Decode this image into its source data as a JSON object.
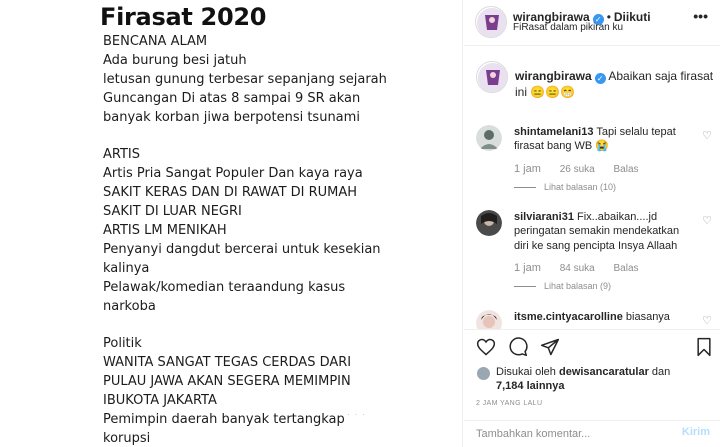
{
  "post": {
    "title": "Firasat 2020",
    "lines": [
      "BENCANA ALAM",
      "Ada burung besi jatuh",
      "letusan gunung terbesar sepanjang sejarah",
      "Guncangan Di atas 8 sampai 9 SR akan",
      "banyak korban jiwa berpotensi tsunami",
      "",
      "ARTIS",
      "Artis Pria Sangat Populer Dan kaya raya",
      "SAKIT KERAS DAN DI RAWAT DI RUMAH",
      "SAKIT DI LUAR NEGRI",
      "ARTIS LM MENIKAH",
      "Penyanyi dangdut bercerai untuk kesekian",
      "kalinya",
      "Pelawak/komedian teraandung kasus",
      "narkoba",
      "",
      "Politik",
      "WANITA SANGAT TEGAS CERDAS DARI",
      "PULAU JAWA AKAN SEGERA MEMIMPIN",
      "IBUKOTA JAKARTA",
      "Pemimpin daerah banyak tertangkap",
      "korupsi"
    ]
  },
  "header": {
    "username": "wirangbirawa",
    "separator": "•",
    "follow_status": "Diikuti",
    "location": "FiRasat dalam pikiran ku"
  },
  "caption": {
    "username": "wirangbirawa",
    "text": "Abaikan saja firasat ini 😑😑😁"
  },
  "comments": [
    {
      "username": "shintamelani13",
      "text": "Tapi selalu tepat firasat bang WB 😭",
      "time": "1 jam",
      "likes": "26 suka",
      "reply": "Balas",
      "view_replies": "Lihat balasan (10)"
    },
    {
      "username": "silviarani31",
      "text": "Fix..abaikan....jd peringatan semakin mendekatkan diri ke sang pencipta Insya Allaah",
      "time": "1 jam",
      "likes": "84 suka",
      "reply": "Balas",
      "view_replies": "Lihat balasan (9)"
    },
    {
      "username": "itsme.cintyacarolline",
      "text": "biasanya"
    }
  ],
  "likes": {
    "prefix": "Disukai oleh",
    "user": "dewisancaratular",
    "middle": "dan",
    "count": "7,184 lainnya"
  },
  "posted_time": "2 JAM YANG LALU",
  "add_comment": {
    "placeholder": "Tambahkan komentar...",
    "post_label": "Kirim"
  },
  "colors": {
    "verified": "#3897f0",
    "muted": "#8e8e8e",
    "post_button_disabled": "#b2dffc"
  }
}
